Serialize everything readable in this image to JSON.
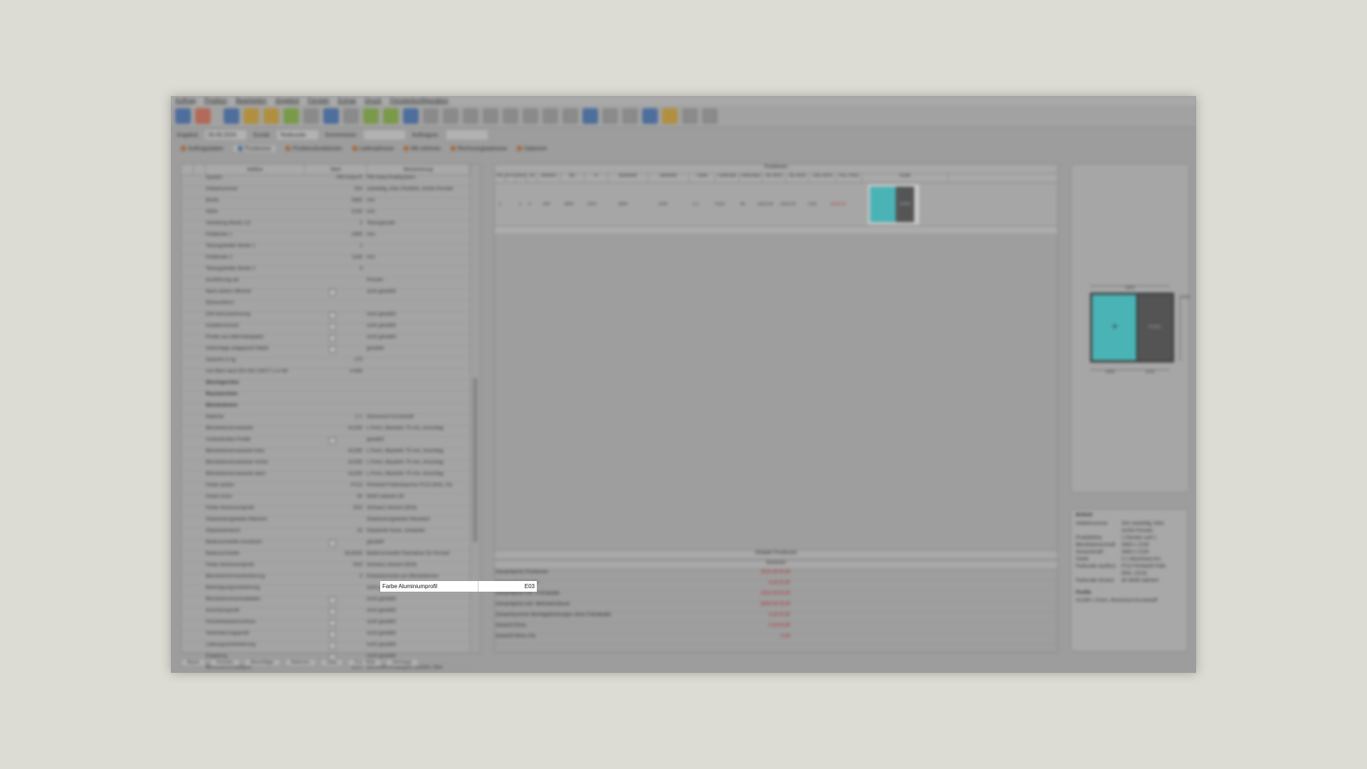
{
  "highlight": {
    "label": "Farbe Aluminiumprofil",
    "value": "E03"
  },
  "menu": [
    "Auftrag",
    "Position",
    "Bearbeiten",
    "Angebot",
    "Fenster",
    "Extras",
    "Druck",
    "Fensterkonfiguration"
  ],
  "info": {
    "a_label": "Angebot",
    "a_value": "26.06.2024",
    "b_label": "Kunde",
    "b_value": "Testkunde",
    "c_label": "Kommission",
    "d_label": "Auftragsnr."
  },
  "tabs": [
    "Auftragsdaten",
    "Positionen",
    "Positionsfunktionen",
    "Lieferadresse",
    "Mit nehmen",
    "Rechnungsadresse",
    "Optionen"
  ],
  "left_headers": [
    "Attribut",
    "Wert",
    "Bezeichnung"
  ],
  "rows": [
    {
      "a": "System",
      "v": "PM-Vista-Fl",
      "d": "PM-Vista Profilsystem",
      "g": false
    },
    {
      "a": "Artikelnummer",
      "v": "204",
      "d": "zweiteilig, links Festfeld, rechts Fenster",
      "g": false
    },
    {
      "a": "Breite",
      "v": "2800",
      "d": "mm",
      "g": false
    },
    {
      "a": "Höhe",
      "v": "2100",
      "d": "mm",
      "g": false
    },
    {
      "a": "Verteilung Breite 1/2",
      "v": "2",
      "d": "Teilungsmaß",
      "g": false
    },
    {
      "a": "Feldbreite 1",
      "v": "1600",
      "d": "mm",
      "g": false
    },
    {
      "a": "Teilungsfelder Breite 1",
      "v": "1",
      "d": "",
      "g": false
    },
    {
      "a": "Feldbreite 2",
      "v": "1100",
      "d": "mm",
      "g": false
    },
    {
      "a": "Teilungsfelder Breite 2",
      "v": "0",
      "d": "",
      "g": false
    },
    {
      "a": "Ausführung als",
      "v": "",
      "d": "Fenster",
      "g": false
    },
    {
      "a": "Nach außen öffnend",
      "v": "chk",
      "d": "nicht gewählt",
      "g": false
    },
    {
      "a": "Elementform",
      "v": "",
      "d": "",
      "g": false
    },
    {
      "a": "DIN Kennzeichnung",
      "v": "chk",
      "d": "nicht gewählt",
      "g": false
    },
    {
      "a": "Insektenschutz",
      "v": "chk",
      "d": "nicht gewählt",
      "g": false
    },
    {
      "a": "Profile aus Alternativpaket",
      "v": "chk",
      "d": "nicht gewählt",
      "g": false
    },
    {
      "a": "Höhenlage aufgeputzt Maße",
      "v": "chk",
      "d": "gewählt",
      "g": false
    },
    {
      "a": "Gewicht in kg",
      "v": "175",
      "d": "",
      "g": false
    },
    {
      "a": "Uw-Wert nach EN ISO 10077-1 in W/",
      "v": "0.000",
      "d": "",
      "g": false
    },
    {
      "a": "Wischgarnitur",
      "v": "",
      "d": "",
      "g": true
    },
    {
      "a": "Rauswechlen",
      "v": "",
      "d": "",
      "g": true
    },
    {
      "a": "Blendrahmen",
      "v": "",
      "d": "",
      "g": true
    },
    {
      "a": "Material",
      "v": "2-1",
      "d": "Aluminium-Kunststoff",
      "g": false
    },
    {
      "a": "Blendrahmenvariante",
      "v": "A1290",
      "d": "L-Form, Bautiefe 75 mm, Anschlag",
      "g": false
    },
    {
      "a": "Umlaufendes Profile",
      "v": "chk",
      "d": "gewählt",
      "g": false
    },
    {
      "a": "Blendrahmenvariante links",
      "v": "A1290",
      "d": "L-Form, Bautiefe 75 mm, Anschlag",
      "g": false
    },
    {
      "a": "Blendrahmenvariante rechts",
      "v": "A1290",
      "d": "L-Form, Bautiefe 75 mm, Anschlag",
      "g": false
    },
    {
      "a": "Blendrahmenvariante oben",
      "v": "A1290",
      "d": "L-Form, Bautiefe 75 mm, Anschlag",
      "g": false
    },
    {
      "a": "Farbe außen",
      "v": "P113",
      "d": "Perlweiß Folienkaschur P113 (RAL 10)",
      "g": false
    },
    {
      "a": "Farbe innen",
      "v": "40",
      "d": "Weiß satiniert 40",
      "g": false
    },
    {
      "a": "Farbe Aluminiumprofil",
      "v": "E03",
      "d": "Schwarz eloxiert (E03)",
      "g": false
    },
    {
      "a": "Glasleistungsfarbe Rahmen",
      "v": "",
      "d": "Glasleistungsfarbe Standard",
      "g": false
    },
    {
      "a": "Glasleistenform",
      "v": "16",
      "d": "Glasleiste Nova, verkantet",
      "g": false
    },
    {
      "a": "Bodenschwelle einsetzen",
      "v": "chk",
      "d": "gewählt",
      "g": false
    },
    {
      "a": "Bodenschwelle",
      "v": "B14000",
      "d": "Bodenschwelle Flachdose für Fenster",
      "g": false
    },
    {
      "a": "Farbe Aluminiumprofil",
      "v": "E03",
      "d": "Schwarz eloxiert (E03)",
      "g": false
    },
    {
      "a": "Blendrahmenverbreiterung",
      "v": "0",
      "d": "Einbaukonsole am Blendrahmen",
      "g": false
    },
    {
      "a": "Befestigungsvorbohrung",
      "v": "",
      "d": "nicht gewählt",
      "g": false
    },
    {
      "a": "Blendrahmenschubladen",
      "v": "chk",
      "d": "nicht gewählt",
      "g": false
    },
    {
      "a": "Anschlussprofil",
      "v": "chk",
      "d": "nicht gewählt",
      "g": false
    },
    {
      "a": "Fensterbankanschluss",
      "v": "chk",
      "d": "nicht gewählt",
      "g": false
    },
    {
      "a": "Verbreiterungsprofil",
      "v": "chk",
      "d": "nicht gewählt",
      "g": false
    },
    {
      "a": "Laibungsverbreiterung",
      "v": "chk",
      "d": "nicht gewählt",
      "g": false
    },
    {
      "a": "Kopplung",
      "v": "chk",
      "d": "nicht gewählt",
      "g": false
    },
    {
      "a": "Blendrahmenadapter",
      "v": "4020",
      "d": "Blendrahmenadapter pfosten, Bau",
      "g": false
    },
    {
      "a": "Pfosten",
      "v": "",
      "d": "",
      "g": true
    }
  ],
  "grid": {
    "title": "Positionen",
    "headers": [
      "Pos",
      "B-Pos",
      "Stück",
      "ref",
      "Artikelnr.",
      "B/L",
      "H",
      "Baubreite",
      "Bauhöhe",
      "Farbe",
      "Farbcode",
      "Farbcode2",
      "RE-W/St",
      "RE-W/St",
      "VKE-W/St",
      "Pos.-Preis",
      "Grafik"
    ],
    "row": [
      "1",
      "",
      "1",
      "0",
      "204",
      "2800",
      "2100",
      "2800",
      "2100",
      "2-1",
      "P113",
      "40",
      "2522,00",
      "2522,00",
      "0,00",
      "2522,00"
    ],
    "thumb_label": "ST201"
  },
  "global_title": "Globale Positionen",
  "summen_title": "Summen",
  "sums": [
    {
      "l": "Gesamtpreis Positionen",
      "v": "2522,00 EUR"
    },
    {
      "l": "Summe Fußrabatte",
      "v": "0,00 EUR"
    },
    {
      "l": "Gesamtpreis inkl. Fußrabatte",
      "v": "2522,00 EUR"
    },
    {
      "l": "Gesamtpreis inkl. Mehrwertsteuer",
      "v": "3000,00 EUR"
    },
    {
      "l": "Gesamtsumme Montageleistungen ohne Fußrabatte",
      "v": "0,00 EUR"
    },
    {
      "l": "Gewicht Elmo",
      "v": "0,00 EUR"
    },
    {
      "l": "Gewicht Elmo (%)",
      "v": "0,00"
    }
  ],
  "drawing": {
    "width": "2800",
    "left": "1600",
    "right": "1100",
    "height": "2100",
    "panel_label": "ST201"
  },
  "infopanel": {
    "title": "Einheit",
    "items": [
      {
        "k": "Artikelnummer",
        "v": "204 zweiteilig, links"
      },
      {
        "k": "",
        "v": "rechts Fenster"
      },
      {
        "k": "Produktfreq",
        "v": "1 Fenster und 1"
      },
      {
        "k": "Blendrahmenmaß",
        "v": "2800 x 2100"
      },
      {
        "k": "Gesamtmaß",
        "v": "2800 x 2100"
      },
      {
        "k": "Farbe",
        "v": "2-1 Aluminium-Ku"
      },
      {
        "k": "Farbcode (außen)",
        "v": "P113 Perlweiß Folie"
      },
      {
        "k": "",
        "v": "(RAL 1013)"
      },
      {
        "k": "Farbcode (innen)",
        "v": "40 Weiß satiniert"
      }
    ],
    "profile_title": "Profile",
    "profile_text": "A1290 L-Form, Aluminium-Kunststoff"
  },
  "bottom_tabs": [
    "Basis",
    "Fenster",
    "Beschläge",
    "Rahmen",
    "Glas",
    "Zus. Teile",
    "Montage"
  ]
}
